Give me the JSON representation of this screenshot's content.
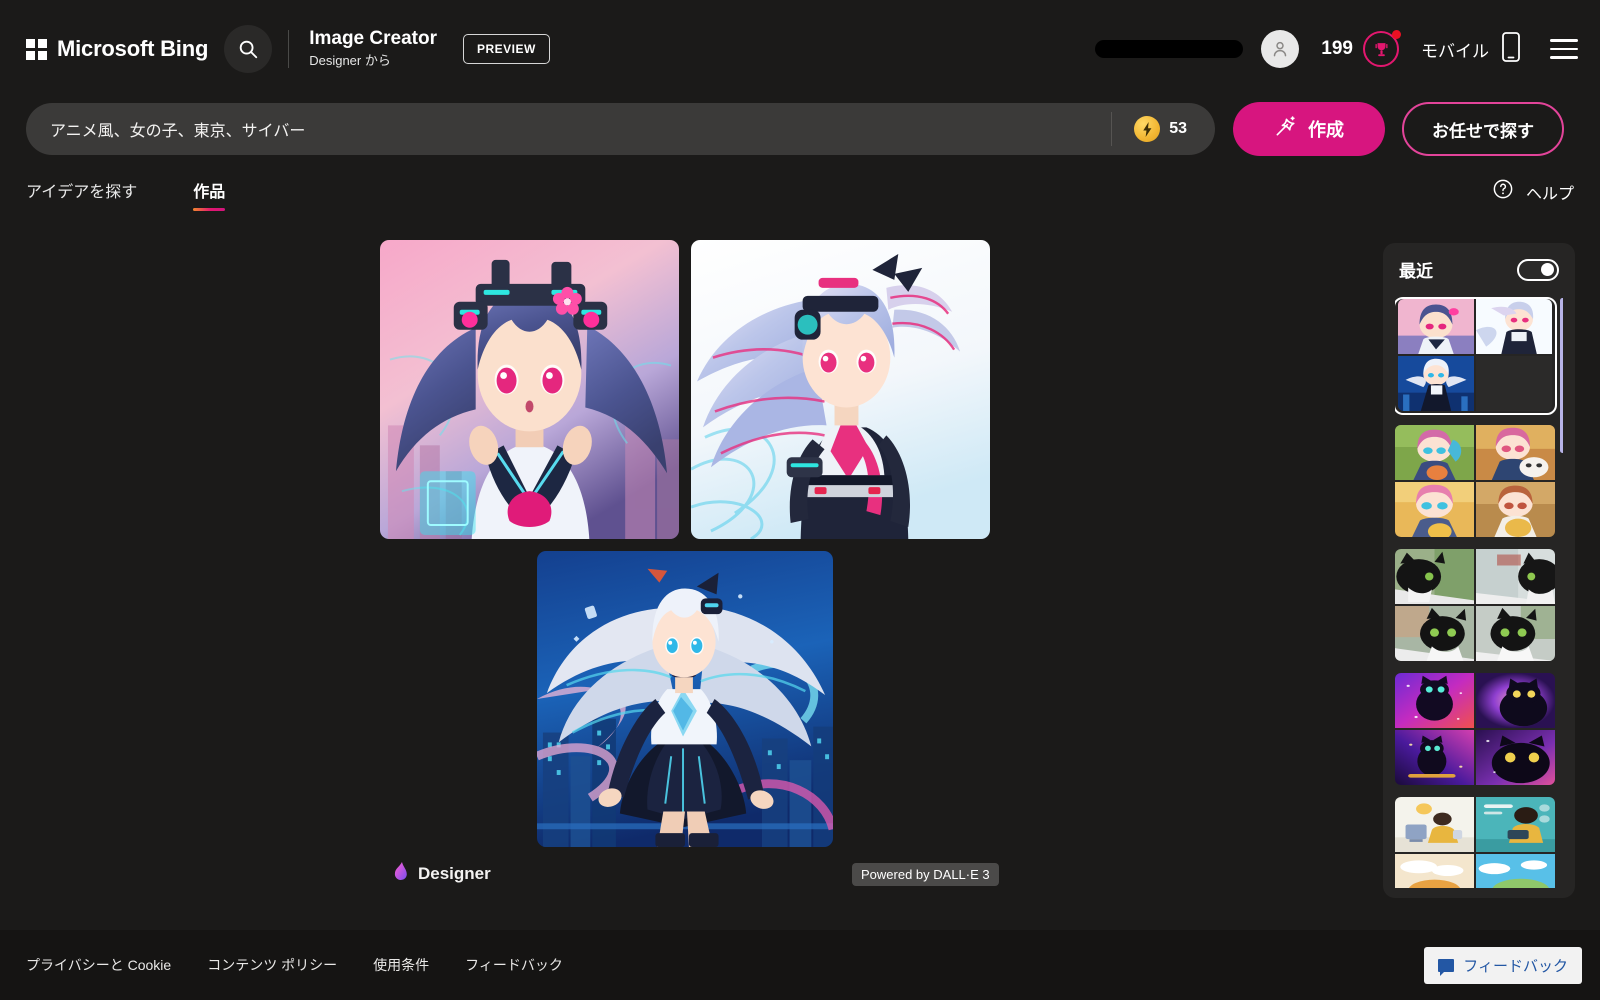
{
  "header": {
    "brand": "Microsoft Bing",
    "search_icon": "search-icon",
    "app_title": "Image Creator",
    "app_subtitle": "Designer から",
    "preview_label": "PREVIEW",
    "points": "199",
    "rewards_icon": "rewards-trophy-icon",
    "mobile_label": "モバイル",
    "phone_icon": "phone-icon",
    "menu_icon": "hamburger-menu-icon",
    "avatar_icon": "person-avatar-icon"
  },
  "prompt": {
    "value": "アニメ風、女の子、東京、サイバー",
    "placeholder": "アニメ風、女の子、東京、サイバー",
    "boost_icon": "lightning-bolt-icon",
    "boost_count": "53",
    "create_label": "作成",
    "create_icon": "magic-wand-icon",
    "surprise_label": "お任せで探す"
  },
  "tabs": [
    {
      "label": "アイデアを探す",
      "active": false
    },
    {
      "label": "作品",
      "active": true
    }
  ],
  "help": {
    "icon": "question-circle-icon",
    "label": "ヘルプ"
  },
  "results": {
    "images": [
      {
        "alt": "アニメ風サイバーパンク少女 ヘッドホン ピンク背景",
        "name": "result-image-1"
      },
      {
        "alt": "アニメ風サイバーパンク少女 白背景 ツインテール",
        "name": "result-image-2"
      },
      {
        "alt": "アニメ風サイバーパンク少女 夜の都市 全身",
        "name": "result-image-3"
      }
    ],
    "designer_label": "Designer",
    "dalle_badge": "Powered by DALL·E 3"
  },
  "sidebar": {
    "title": "最近",
    "toggle_on": true,
    "history": [
      {
        "name": "history-item-1",
        "selected": true,
        "kind": "anime-cyber-girl",
        "count": 3
      },
      {
        "name": "history-item-2",
        "selected": false,
        "kind": "kawaii-girl-plush",
        "count": 4
      },
      {
        "name": "history-item-3",
        "selected": false,
        "kind": "tuxedo-cat-window",
        "count": 4
      },
      {
        "name": "history-item-4",
        "selected": false,
        "kind": "galaxy-black-cat",
        "count": 4
      },
      {
        "name": "history-item-5",
        "selected": false,
        "kind": "flat-illustration-desk",
        "count": 4
      }
    ]
  },
  "footer": {
    "links": [
      "プライバシーと Cookie",
      "コンテンツ ポリシー",
      "使用条件",
      "フィードバック"
    ],
    "feedback_button": "フィードバック",
    "feedback_icon": "speech-bubble-icon"
  },
  "colors": {
    "page_bg": "#1b1a19",
    "footer_bg": "#151413",
    "accent_pink": "#d7157f",
    "accent_pink_border": "#e3449a",
    "panel_bg": "#262524",
    "field_bg": "#3b3a39",
    "boost_gold": "#f2b632",
    "scrollbar": "#b8b4e8",
    "feedback_blue": "#2357a4"
  }
}
